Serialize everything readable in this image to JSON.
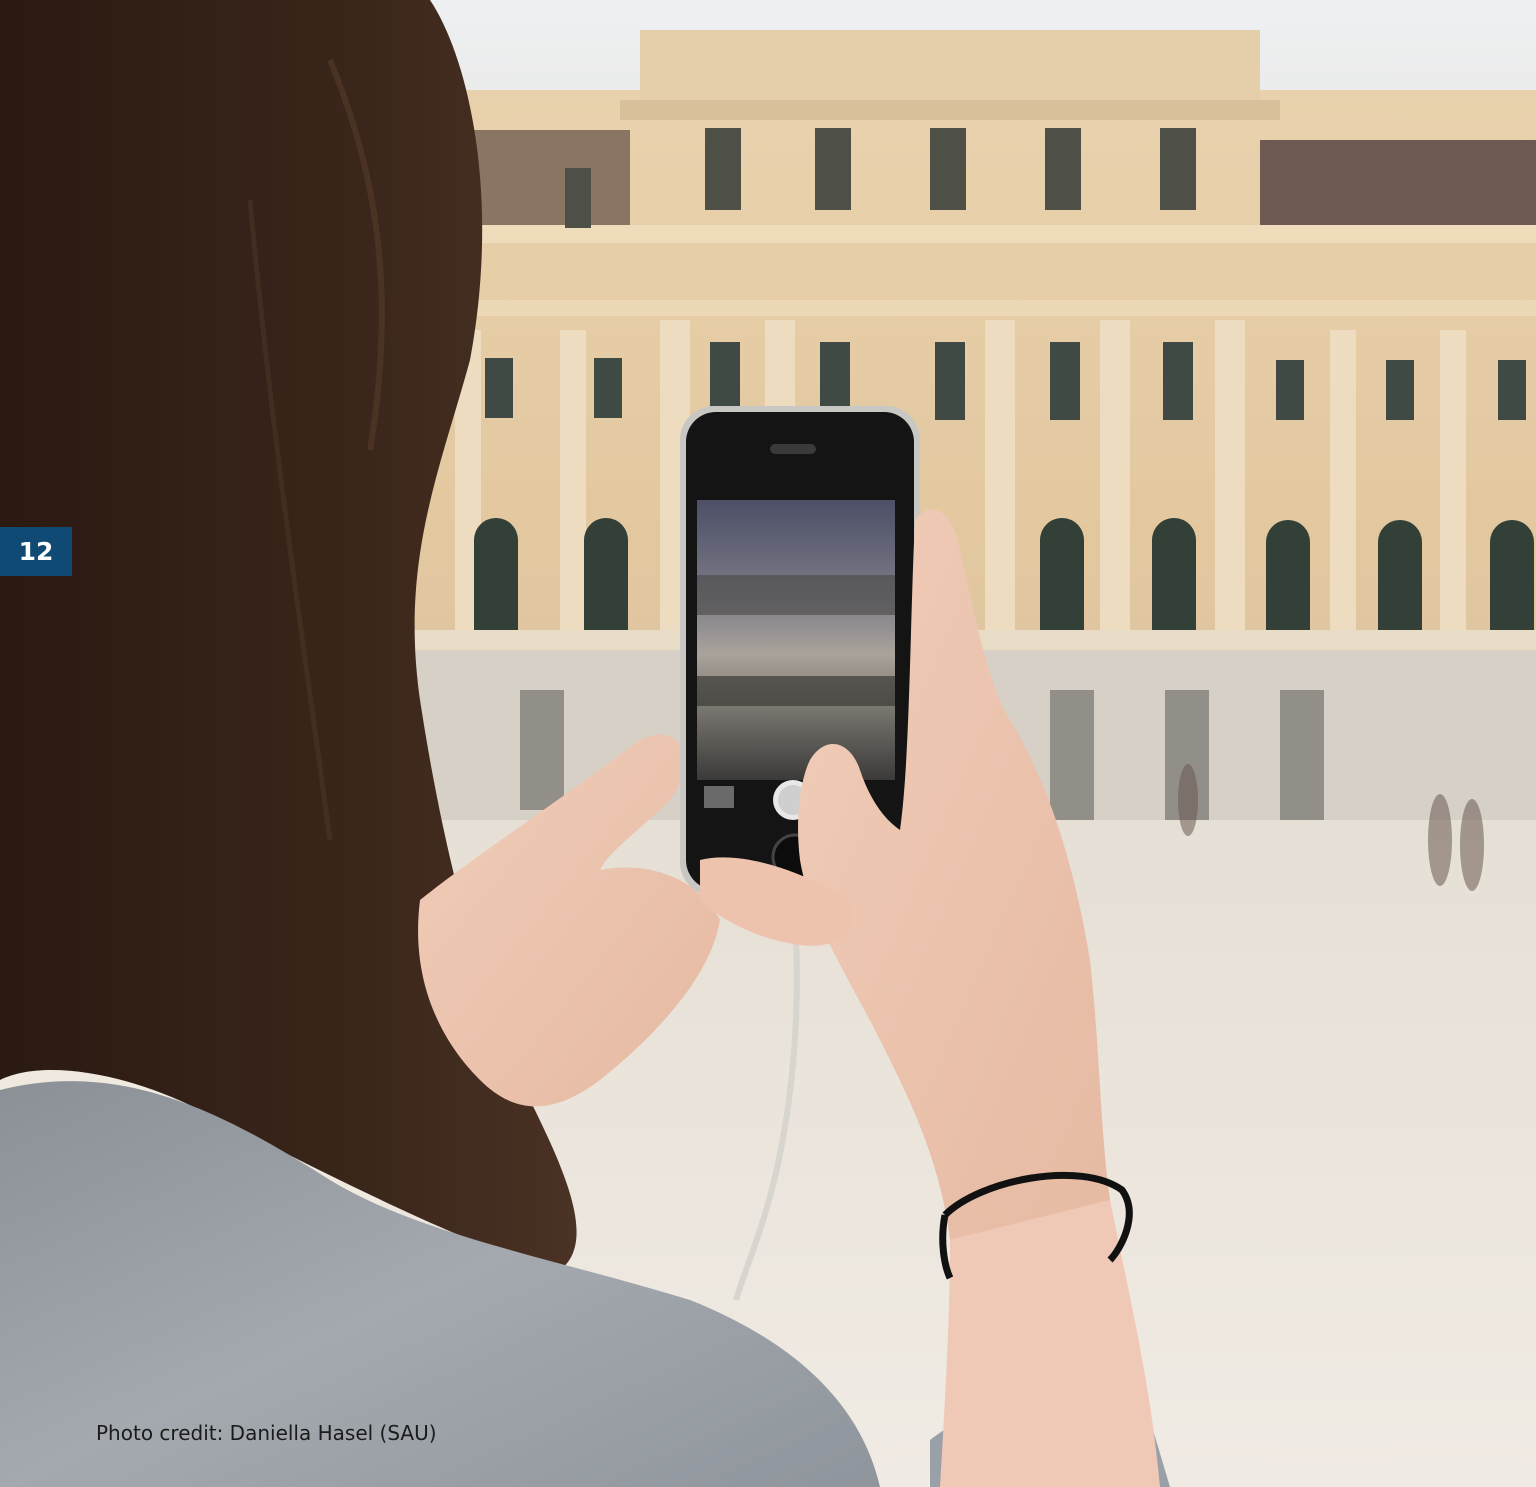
{
  "page": {
    "number": "12",
    "accent_color": "#0e4a73"
  },
  "photo": {
    "subject": "woman photographing a palace facade with a smartphone",
    "credit": "Photo credit: Daniella Hasel (SAU)"
  }
}
